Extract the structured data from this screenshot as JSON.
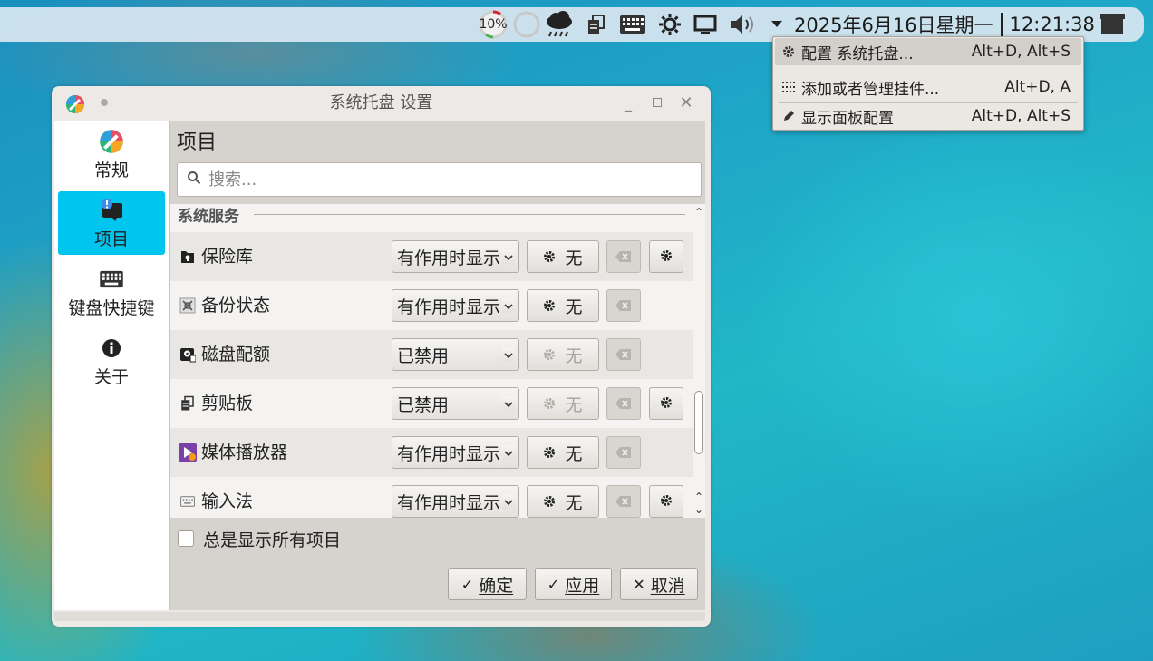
{
  "panel": {
    "battery_percent_label": "10%",
    "clock": {
      "date": "2025年6月16日星期一",
      "time": "12:21:38"
    }
  },
  "menu": {
    "items": [
      {
        "label": "配置 系统托盘...",
        "accel": "Alt+D, Alt+S",
        "icon": "gear-icon"
      },
      {
        "label": "添加或者管理挂件...",
        "accel": "Alt+D, A",
        "icon": "grid-icon"
      },
      {
        "label": "显示面板配置",
        "accel": "Alt+D, Alt+S",
        "icon": "pencil-icon"
      }
    ]
  },
  "window": {
    "title": "系统托盘 设置",
    "sidebar": [
      {
        "label": "常规",
        "icon": "palette-icon"
      },
      {
        "label": "项目",
        "icon": "notification-icon"
      },
      {
        "label": "键盘快捷键",
        "icon": "keyboard-icon"
      },
      {
        "label": "关于",
        "icon": "info-icon"
      }
    ],
    "section_title": "项目",
    "search_placeholder": "搜索...",
    "group_header": "系统服务",
    "rows": [
      {
        "name": "保险库",
        "visibility": "有作用时显示",
        "shortcut": "无",
        "shortcut_enabled": true,
        "has_config": true
      },
      {
        "name": "备份状态",
        "visibility": "有作用时显示",
        "shortcut": "无",
        "shortcut_enabled": true,
        "has_config": false
      },
      {
        "name": "磁盘配额",
        "visibility": "已禁用",
        "shortcut": "无",
        "shortcut_enabled": false,
        "has_config": false
      },
      {
        "name": "剪贴板",
        "visibility": "已禁用",
        "shortcut": "无",
        "shortcut_enabled": false,
        "has_config": true
      },
      {
        "name": "媒体播放器",
        "visibility": "有作用时显示",
        "shortcut": "无",
        "shortcut_enabled": true,
        "has_config": false
      },
      {
        "name": "输入法",
        "visibility": "有作用时显示",
        "shortcut": "无",
        "shortcut_enabled": true,
        "has_config": true
      }
    ],
    "always_show_label": "总是显示所有项目",
    "buttons": {
      "ok": "确定",
      "apply": "应用",
      "cancel": "取消"
    }
  },
  "colors": {
    "accent": "#00c6ef",
    "window_bg": "#ece9e6",
    "list_bg": "#f4f3f1"
  }
}
